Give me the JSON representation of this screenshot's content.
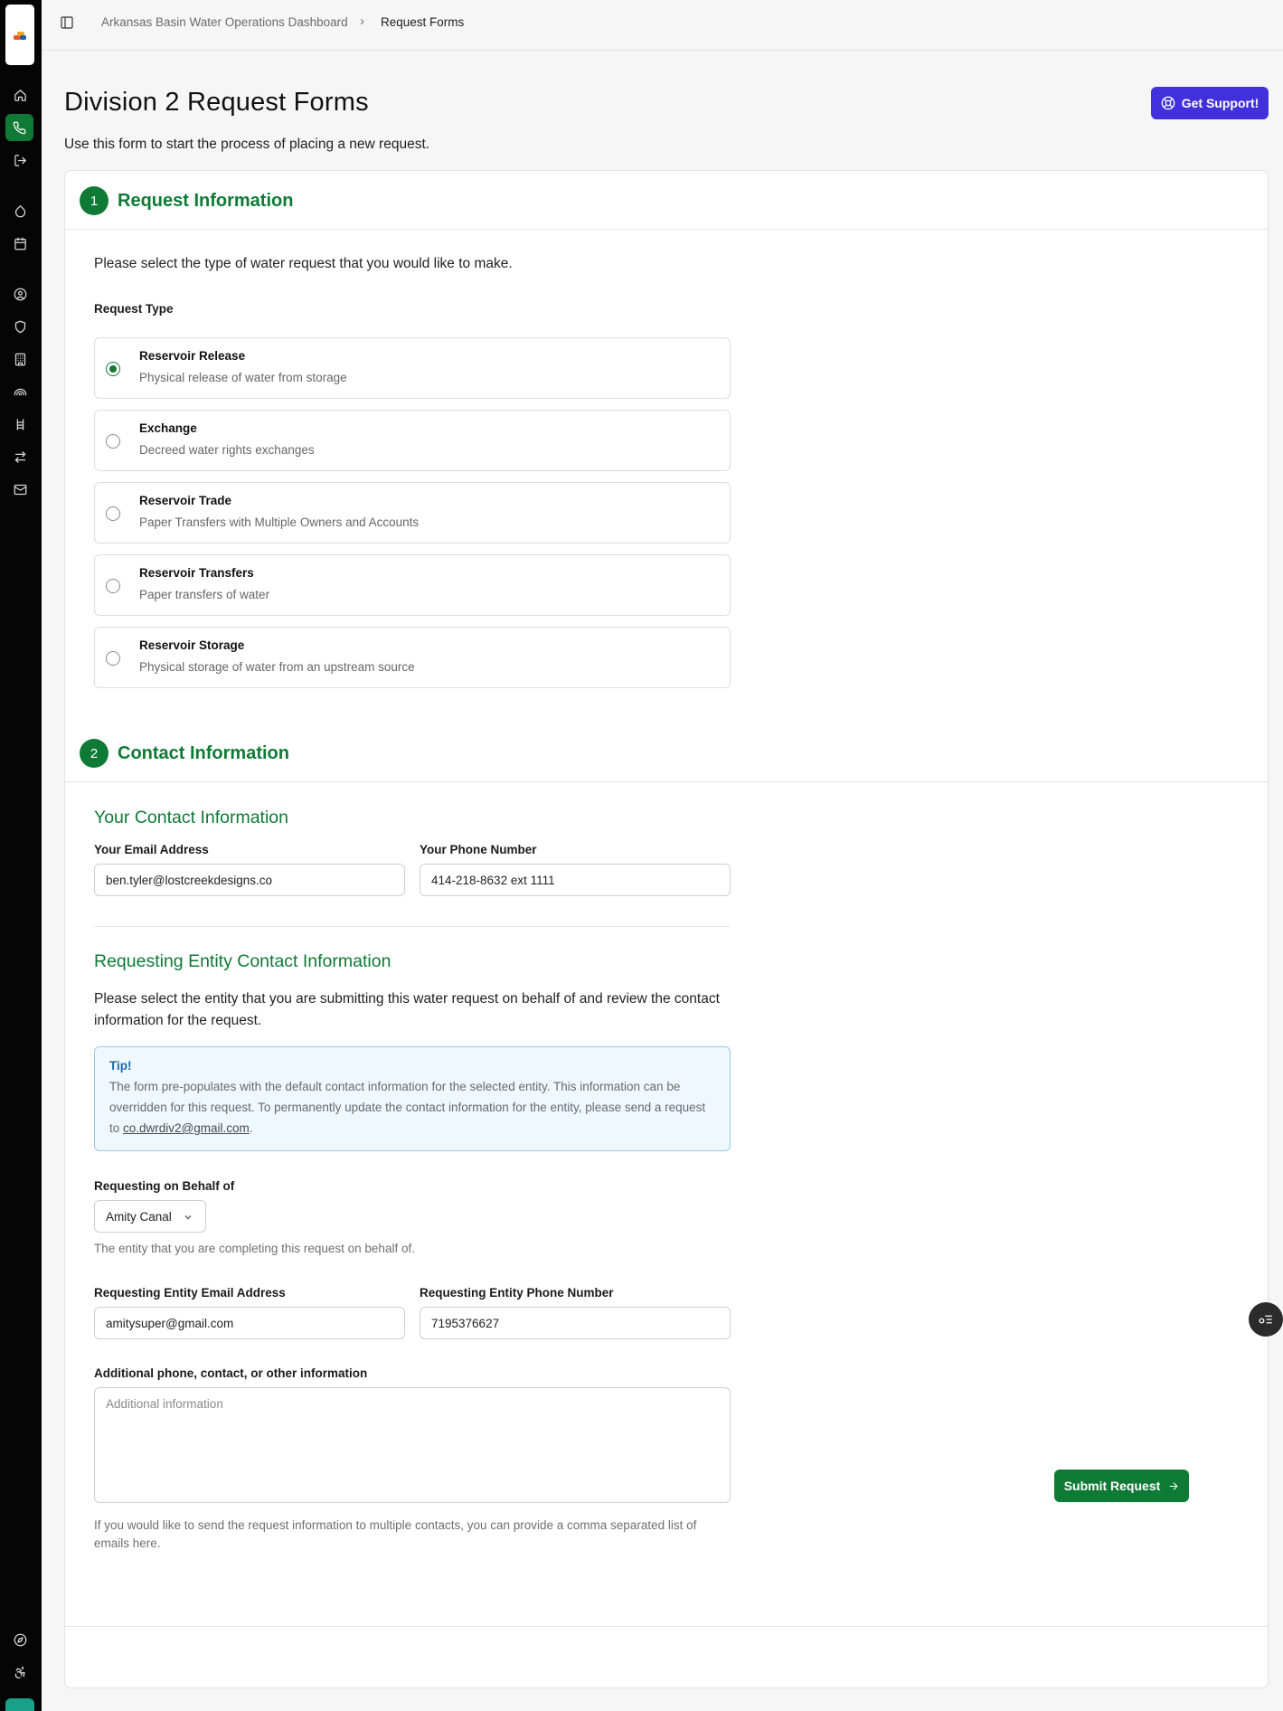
{
  "breadcrumb": {
    "root": "Arkansas Basin Water Operations Dashboard",
    "separator": "›",
    "current": "Request Forms"
  },
  "page": {
    "title": "Division 2 Request Forms",
    "subtitle": "Use this form to start the process of placing a new request.",
    "support_label": "Get Support!"
  },
  "sidebar": {
    "icons": [
      "home-icon",
      "phone-icon",
      "logout-icon",
      "droplet-icon",
      "calendar-icon",
      "user-circle-icon",
      "shield-icon",
      "building-icon",
      "rainbow-icon",
      "ladder-icon",
      "transfer-icon",
      "mail-icon",
      "compass-icon",
      "accessibility-icon"
    ],
    "active": "phone-icon"
  },
  "step1": {
    "number": "1",
    "title": "Request Information",
    "lead": "Please select the type of water request that you would like to make.",
    "request_type_label": "Request Type",
    "options": [
      {
        "title": "Reservoir Release",
        "desc": "Physical release of water from storage",
        "checked": true
      },
      {
        "title": "Exchange",
        "desc": "Decreed water rights exchanges",
        "checked": false
      },
      {
        "title": "Reservoir Trade",
        "desc": "Paper Transfers with Multiple Owners and Accounts",
        "checked": false
      },
      {
        "title": "Reservoir Transfers",
        "desc": "Paper transfers of water",
        "checked": false
      },
      {
        "title": "Reservoir Storage",
        "desc": "Physical storage of water from an upstream source",
        "checked": false
      }
    ]
  },
  "step2": {
    "number": "2",
    "title": "Contact Information",
    "your_contact": {
      "heading": "Your Contact Information",
      "email_label": "Your Email Address",
      "email_value": "ben.tyler@lostcreekdesigns.co",
      "phone_label": "Your Phone Number",
      "phone_value": "414-218-8632 ext 1111"
    },
    "entity": {
      "heading": "Requesting Entity Contact Information",
      "description": "Please select the entity that you are submitting this water request on behalf of and review the contact information for the request.",
      "tip_title": "Tip!",
      "tip_body": "The form pre-populates with the default contact information for the selected entity. This information can be overridden for this request. To permanently update the contact information for the entity, please send a request to",
      "tip_link": "co.dwrdiv2@gmail.com",
      "tip_end": ".",
      "behalf_label": "Requesting on Behalf of",
      "behalf_value": "Amity Canal",
      "behalf_help": "The entity that you are completing this request on behalf of.",
      "email_label": "Requesting Entity Email Address",
      "email_value": "amitysuper@gmail.com",
      "phone_label": "Requesting Entity Phone Number",
      "phone_value": "7195376627",
      "additional_label": "Additional phone, contact, or other information",
      "additional_placeholder": "Additional information",
      "additional_help": "If you would like to send the request information to multiple contacts, you can provide a comma separated list of emails here."
    }
  },
  "submit_label": "Submit Request",
  "colors": {
    "brand_green": "#0e7a35",
    "support_purple": "#4330dd",
    "sidebar": "#050505",
    "tip_bg": "#eef8fe"
  }
}
